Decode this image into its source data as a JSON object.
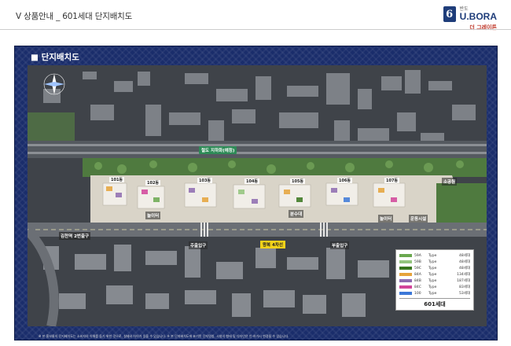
{
  "header": {
    "title": "Ⅴ 상품안내 _ 601세대 단지배치도",
    "logo_small": "반도",
    "logo_main": "U.BORA",
    "logo_sub": "더 그레이튼",
    "logo_mark": "6"
  },
  "section": {
    "title": "■ 단지배치도"
  },
  "map": {
    "subway": "철도 지하화(예정)",
    "exit": "김천역 2번출구",
    "road": "왕복 4차선",
    "entrances": [
      "주출입구",
      "부출입구"
    ],
    "facilities": [
      "놀이터",
      "분수대",
      "놀이터",
      "운동시설",
      "소공원"
    ],
    "buildings": [
      "101동",
      "102동",
      "103동",
      "104동",
      "105동",
      "106동",
      "107동"
    ]
  },
  "legend": {
    "rows": [
      {
        "type": "59A",
        "label": "Type",
        "count": "48세대",
        "color": "#6aa84f"
      },
      {
        "type": "59B",
        "label": "Type",
        "count": "48세대",
        "color": "#93c47d"
      },
      {
        "type": "59C",
        "label": "Type",
        "count": "48세대",
        "color": "#38761d"
      },
      {
        "type": "84A",
        "label": "Type",
        "count": "134세대",
        "color": "#e6a33a"
      },
      {
        "type": "84B",
        "label": "Type",
        "count": "187세대",
        "color": "#8e6bb0"
      },
      {
        "type": "84C",
        "label": "Type",
        "count": "83세대",
        "color": "#d2449a"
      },
      {
        "type": "100",
        "label": "Type",
        "count": "53세대",
        "color": "#3c78d8"
      }
    ],
    "total": "601세대"
  },
  "footnote": "※ 본 홍보물의 단지배치도는 소비자의 이해를 돕기 위한 것으로, 실제와 차이가 있을 수 있습니다. ※ 본 단지배치도에 표기된 단지명칭, 시설의 형태 및 디자인은 인·허가시 변경될 수 있습니다."
}
